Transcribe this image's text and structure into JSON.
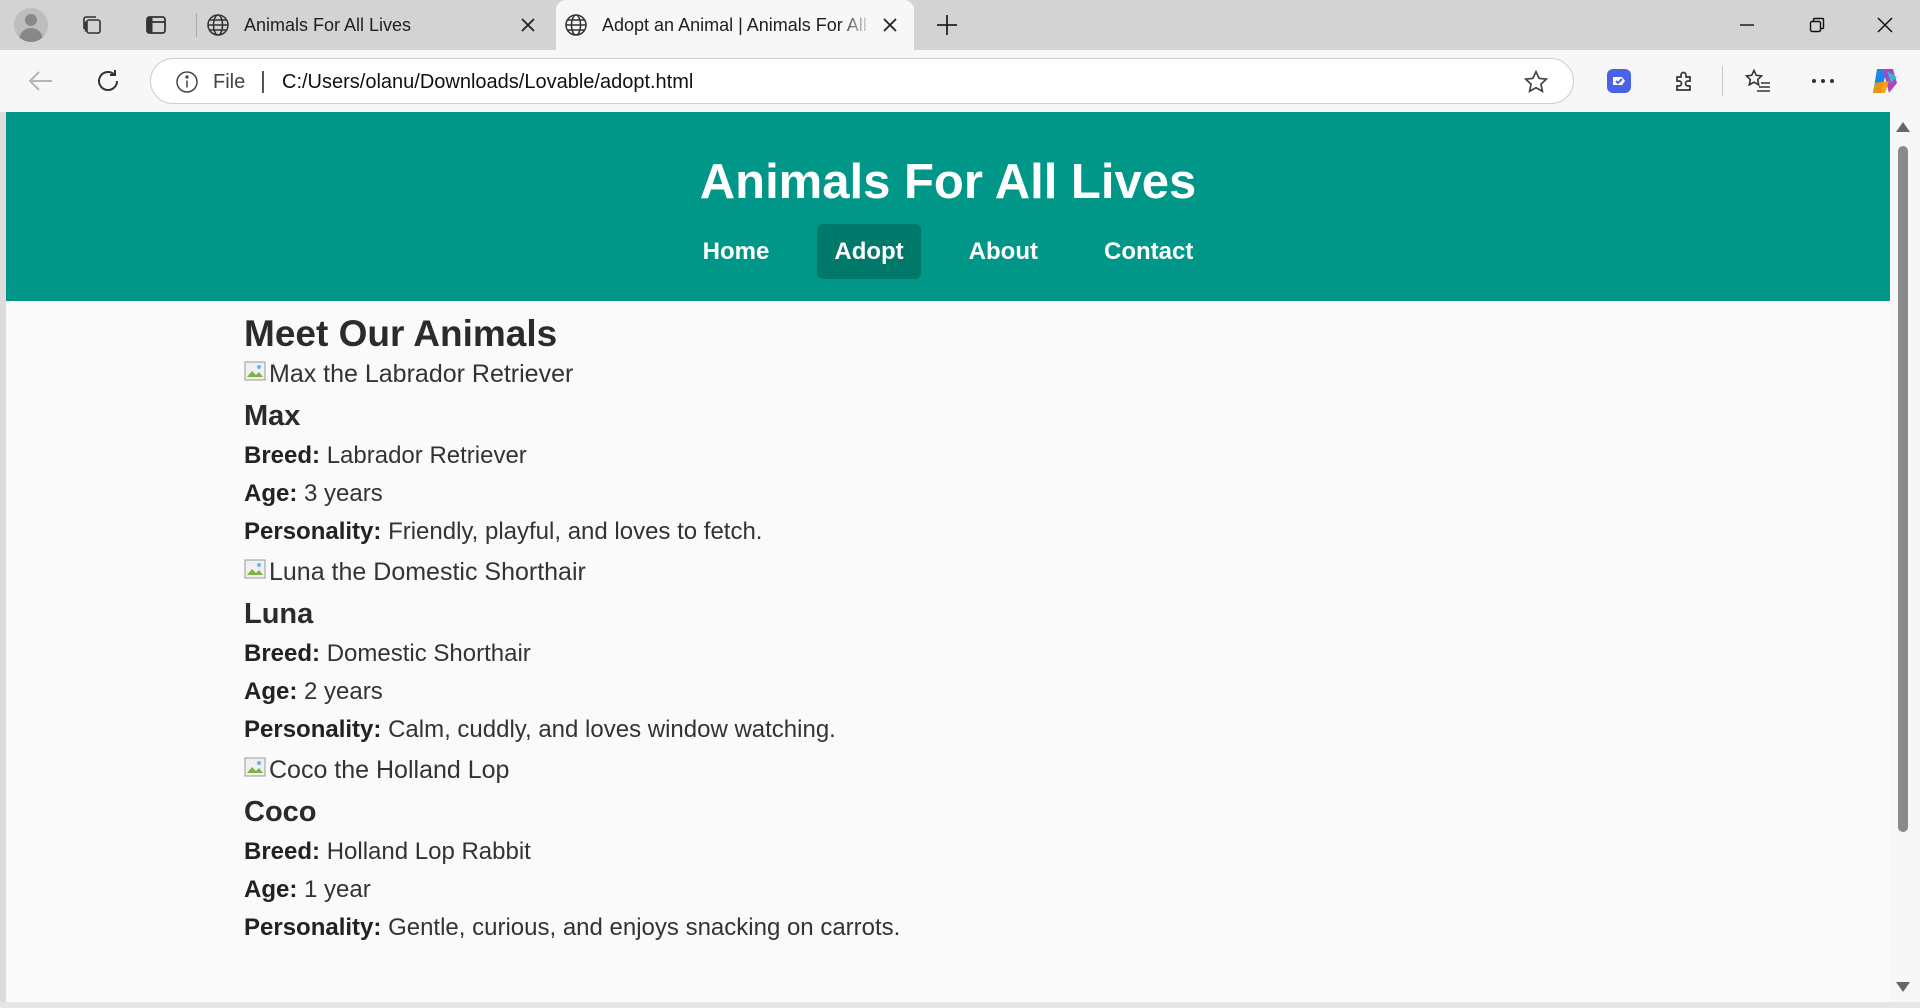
{
  "browser": {
    "tabs": [
      {
        "title": "Animals For All Lives",
        "icon": "globe-icon",
        "active": false
      },
      {
        "title": "Adopt an Animal | Animals For All Lives",
        "icon": "globe-icon",
        "active": true
      }
    ],
    "address_bar": {
      "scheme_label": "File",
      "url": "C:/Users/olanu/Downloads/Lovable/adopt.html"
    }
  },
  "site": {
    "title": "Animals For All Lives",
    "header_color": "#009688",
    "active_nav_color": "#00796b",
    "nav": [
      {
        "label": "Home",
        "active": false
      },
      {
        "label": "Adopt",
        "active": true
      },
      {
        "label": "About",
        "active": false
      },
      {
        "label": "Contact",
        "active": false
      }
    ]
  },
  "main": {
    "heading": "Meet Our Animals",
    "labels": {
      "breed": "Breed:",
      "age": "Age:",
      "personality": "Personality:"
    },
    "animals": [
      {
        "image_alt": "Max the Labrador Retriever",
        "name": "Max",
        "breed": "Labrador Retriever",
        "age": "3 years",
        "personality": "Friendly, playful, and loves to fetch."
      },
      {
        "image_alt": "Luna the Domestic Shorthair",
        "name": "Luna",
        "breed": "Domestic Shorthair",
        "age": "2 years",
        "personality": "Calm, cuddly, and loves window watching."
      },
      {
        "image_alt": "Coco the Holland Lop",
        "name": "Coco",
        "breed": "Holland Lop Rabbit",
        "age": "1 year",
        "personality": "Gentle, curious, and enjoys snacking on carrots."
      }
    ]
  }
}
